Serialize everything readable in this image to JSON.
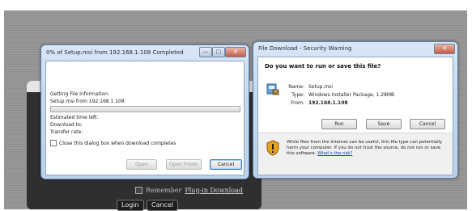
{
  "login": {
    "remember_label": "Remember",
    "plugin_link": "Plug-in Download",
    "login_button": "Login",
    "cancel_button": "Cancel"
  },
  "progress_dialog": {
    "title": "0% of Setup.msi from 192.168.1.108 Completed",
    "status": "Getting File Information:",
    "file_line": "Setup.msi from 192.168.1.108",
    "progress_fraction": 0.0,
    "estimated_label": "Estimated time left:",
    "download_to_label": "Download to:",
    "transfer_rate_label": "Transfer rate:",
    "close_checkbox_label": "Close this dialog box when download completes",
    "open_button": "Open",
    "open_folder_button": "Open Folder",
    "cancel_button": "Cancel",
    "close_glyph": "✕",
    "minimize_glyph": "—",
    "maximize_glyph": "□"
  },
  "security_dialog": {
    "title": "File Download - Security Warning",
    "question": "Do you want to run or save this file?",
    "name_label": "Name:",
    "name_value": "Setup.msi",
    "type_label": "Type:",
    "type_value": "Windows Installer Package, 1.28MB",
    "from_label": "From:",
    "from_value": "192.168.1.108",
    "run_button": "Run",
    "save_button": "Save",
    "cancel_button": "Cancel",
    "warning_text": "While files from the Internet can be useful, this file type can potentially harm your computer. If you do not trust the source, do not run or save this software.",
    "risk_link": "What's the risk?",
    "close_glyph": "✕"
  },
  "colors": {
    "progress_fill": "#4fb34f",
    "link": "#0645ad"
  }
}
